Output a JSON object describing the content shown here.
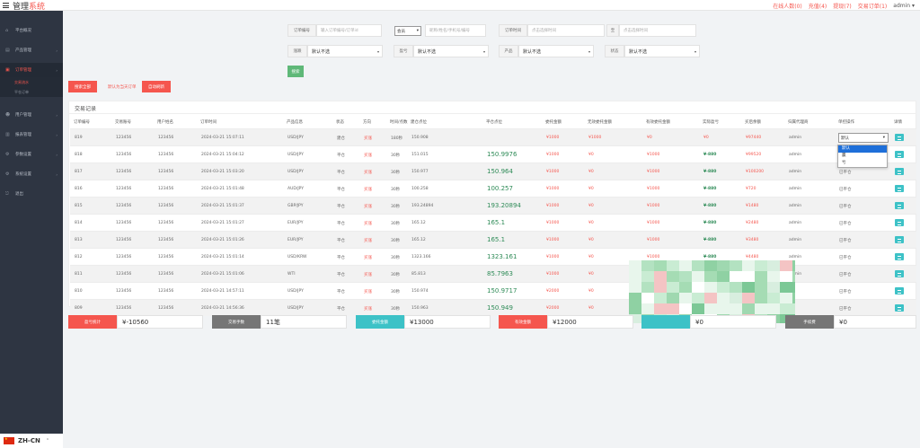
{
  "header": {
    "title": "管理",
    "title_accent": "系统",
    "nav": [
      "在线人数(0)",
      "充值(4)",
      "提现(7)",
      "交易订单(1)"
    ],
    "user": "admin"
  },
  "sidebar": {
    "items": [
      {
        "label": "平台概况",
        "icon": "home-icon"
      },
      {
        "label": "产品管理",
        "icon": "product-icon"
      },
      {
        "label": "订单管理",
        "icon": "order-icon"
      },
      {
        "label": "用户管理",
        "icon": "user-icon"
      },
      {
        "label": "报表管理",
        "icon": "report-icon"
      },
      {
        "label": "参数设置",
        "icon": "settings-icon"
      },
      {
        "label": "系统设置",
        "icon": "system-icon"
      },
      {
        "label": "退出",
        "icon": "logout-icon"
      }
    ],
    "subitems": [
      "交易流水",
      "平仓订单"
    ],
    "language": "ZH-CN"
  },
  "filters": {
    "order_no_label": "订单编号",
    "order_no_placeholder": "输入订单编号/订单id",
    "user_select": "会员",
    "user_placeholder": "昵称/姓名/手机号/编号",
    "order_time_label": "订单时间",
    "time_start_placeholder": "点击选择时间",
    "time_sep": "至",
    "time_end_placeholder": "点击选择时间",
    "direction_label": "涨跌",
    "direction_value": "默认不选",
    "profit_label": "盈亏",
    "profit_value": "默认不选",
    "product_label": "产品",
    "product_value": "默认不选",
    "status_label": "状态",
    "status_value": "默认不选",
    "search_button": "搜索",
    "search_all_button": "搜索全部",
    "note": "默认为当天订单",
    "auto_refresh_button": "自动刷新"
  },
  "table": {
    "title": "交易记录",
    "columns": [
      "订单编号",
      "交易账号",
      "用户姓名",
      "订单时间",
      "产品信息",
      "状态",
      "方向",
      "时间/点数",
      "建仓点位",
      "平仓点位",
      "委托金额",
      "无效委托金额",
      "有效委托金额",
      "实际盈亏",
      "买后余额",
      "归属代理商",
      "单控操作",
      "详情"
    ],
    "rows": [
      {
        "id": "819",
        "account": "123456",
        "name": "123456",
        "time": "2024-03-21 15:07:11",
        "product": "USD/JPY",
        "status": "建仓",
        "direction": "买涨",
        "duration": "180秒",
        "open": "150.908",
        "close": "",
        "amount": "¥1000",
        "invalid": "¥1000",
        "valid": "¥0",
        "pnl": "¥0",
        "balance": "¥97440",
        "agent": "admin",
        "op": "默认"
      },
      {
        "id": "818",
        "account": "123456",
        "name": "123456",
        "time": "2024-03-21 15:04:12",
        "product": "USD/JPY",
        "status": "平仓",
        "direction": "买涨",
        "duration": "30秒",
        "open": "151.015",
        "close": "150.9976",
        "amount": "¥1000",
        "invalid": "¥0",
        "valid": "¥1000",
        "pnl": "¥-880",
        "balance": "¥99520",
        "agent": "admin",
        "op": "已平仓"
      },
      {
        "id": "817",
        "account": "123456",
        "name": "123456",
        "time": "2024-03-21 15:03:20",
        "product": "USD/JPY",
        "status": "平仓",
        "direction": "买涨",
        "duration": "30秒",
        "open": "150.977",
        "close": "150.964",
        "amount": "¥1000",
        "invalid": "¥0",
        "valid": "¥1000",
        "pnl": "¥-880",
        "balance": "¥100200",
        "agent": "admin",
        "op": "已平仓"
      },
      {
        "id": "816",
        "account": "123456",
        "name": "123456",
        "time": "2024-03-21 15:01:48",
        "product": "AUD/JPY",
        "status": "平仓",
        "direction": "买涨",
        "duration": "30秒",
        "open": "100.258",
        "close": "100.257",
        "amount": "¥1000",
        "invalid": "¥0",
        "valid": "¥1000",
        "pnl": "¥-880",
        "balance": "¥720",
        "agent": "admin",
        "op": "已平仓"
      },
      {
        "id": "815",
        "account": "123456",
        "name": "123456",
        "time": "2024-03-21 15:01:37",
        "product": "GBP/JPY",
        "status": "平仓",
        "direction": "买涨",
        "duration": "30秒",
        "open": "193.24894",
        "close": "193.20894",
        "amount": "¥1000",
        "invalid": "¥0",
        "valid": "¥1000",
        "pnl": "¥-880",
        "balance": "¥1480",
        "agent": "admin",
        "op": "已平仓"
      },
      {
        "id": "814",
        "account": "123456",
        "name": "123456",
        "time": "2024-03-21 15:01:27",
        "product": "EUR/JPY",
        "status": "平仓",
        "direction": "买涨",
        "duration": "30秒",
        "open": "165.12",
        "close": "165.1",
        "amount": "¥1000",
        "invalid": "¥0",
        "valid": "¥1000",
        "pnl": "¥-880",
        "balance": "¥2480",
        "agent": "admin",
        "op": "已平仓"
      },
      {
        "id": "813",
        "account": "123456",
        "name": "123456",
        "time": "2024-03-21 15:01:26",
        "product": "EUR/JPY",
        "status": "平仓",
        "direction": "买涨",
        "duration": "30秒",
        "open": "165.12",
        "close": "165.1",
        "amount": "¥1000",
        "invalid": "¥0",
        "valid": "¥1000",
        "pnl": "¥-880",
        "balance": "¥3480",
        "agent": "admin",
        "op": "已平仓"
      },
      {
        "id": "812",
        "account": "123456",
        "name": "123456",
        "time": "2024-03-21 15:01:14",
        "product": "USD/KRW",
        "status": "平仓",
        "direction": "买涨",
        "duration": "30秒",
        "open": "1323.166",
        "close": "1323.161",
        "amount": "¥1000",
        "invalid": "¥0",
        "valid": "¥1000",
        "pnl": "¥-880",
        "balance": "¥4480",
        "agent": "admin",
        "op": "已平仓"
      },
      {
        "id": "811",
        "account": "123456",
        "name": "123456",
        "time": "2024-03-21 15:01:06",
        "product": "WTI",
        "status": "平仓",
        "direction": "买涨",
        "duration": "30秒",
        "open": "85.813",
        "close": "85.7963",
        "amount": "¥1000",
        "invalid": "¥0",
        "valid": "¥1000",
        "pnl": "",
        "balance": "¥5480",
        "agent": "admin",
        "op": "已平仓"
      },
      {
        "id": "810",
        "account": "123456",
        "name": "123456",
        "time": "2024-03-21 14:57:11",
        "product": "USD/JPY",
        "status": "平仓",
        "direction": "买涨",
        "duration": "30秒",
        "open": "150.974",
        "close": "150.9717",
        "amount": "¥2000",
        "invalid": "¥0",
        "valid": "",
        "pnl": "",
        "balance": "",
        "agent": "",
        "op": "已平仓"
      },
      {
        "id": "809",
        "account": "123456",
        "name": "123456",
        "time": "2024-03-21 14:56:36",
        "product": "USD/JPY",
        "status": "平仓",
        "direction": "买涨",
        "duration": "30秒",
        "open": "150.963",
        "close": "150.949",
        "amount": "¥2000",
        "invalid": "¥0",
        "valid": "",
        "pnl": "",
        "balance": "",
        "agent": "",
        "op": "已平仓"
      }
    ],
    "dropdown_options": [
      "默认",
      "赢",
      "亏"
    ]
  },
  "summary": [
    {
      "label": "盈亏统计",
      "value": "¥-10560",
      "color": "#f5564e"
    },
    {
      "label": "交易手数",
      "value": "11笔",
      "color": "#767676"
    },
    {
      "label": "委托金额",
      "value": "¥13000",
      "color": "#3dc2c7"
    },
    {
      "label": "有效金额",
      "value": "¥12000",
      "color": "#f5564e"
    },
    {
      "label": "",
      "value": "¥0",
      "color": "#3dc2c7"
    },
    {
      "label": "手续费",
      "value": "¥0",
      "color": "#767676"
    }
  ],
  "colors": {
    "accent": "#f5564e",
    "success": "#5fb878",
    "teal": "#3dc2c7",
    "sidebar": "#2e3542"
  }
}
